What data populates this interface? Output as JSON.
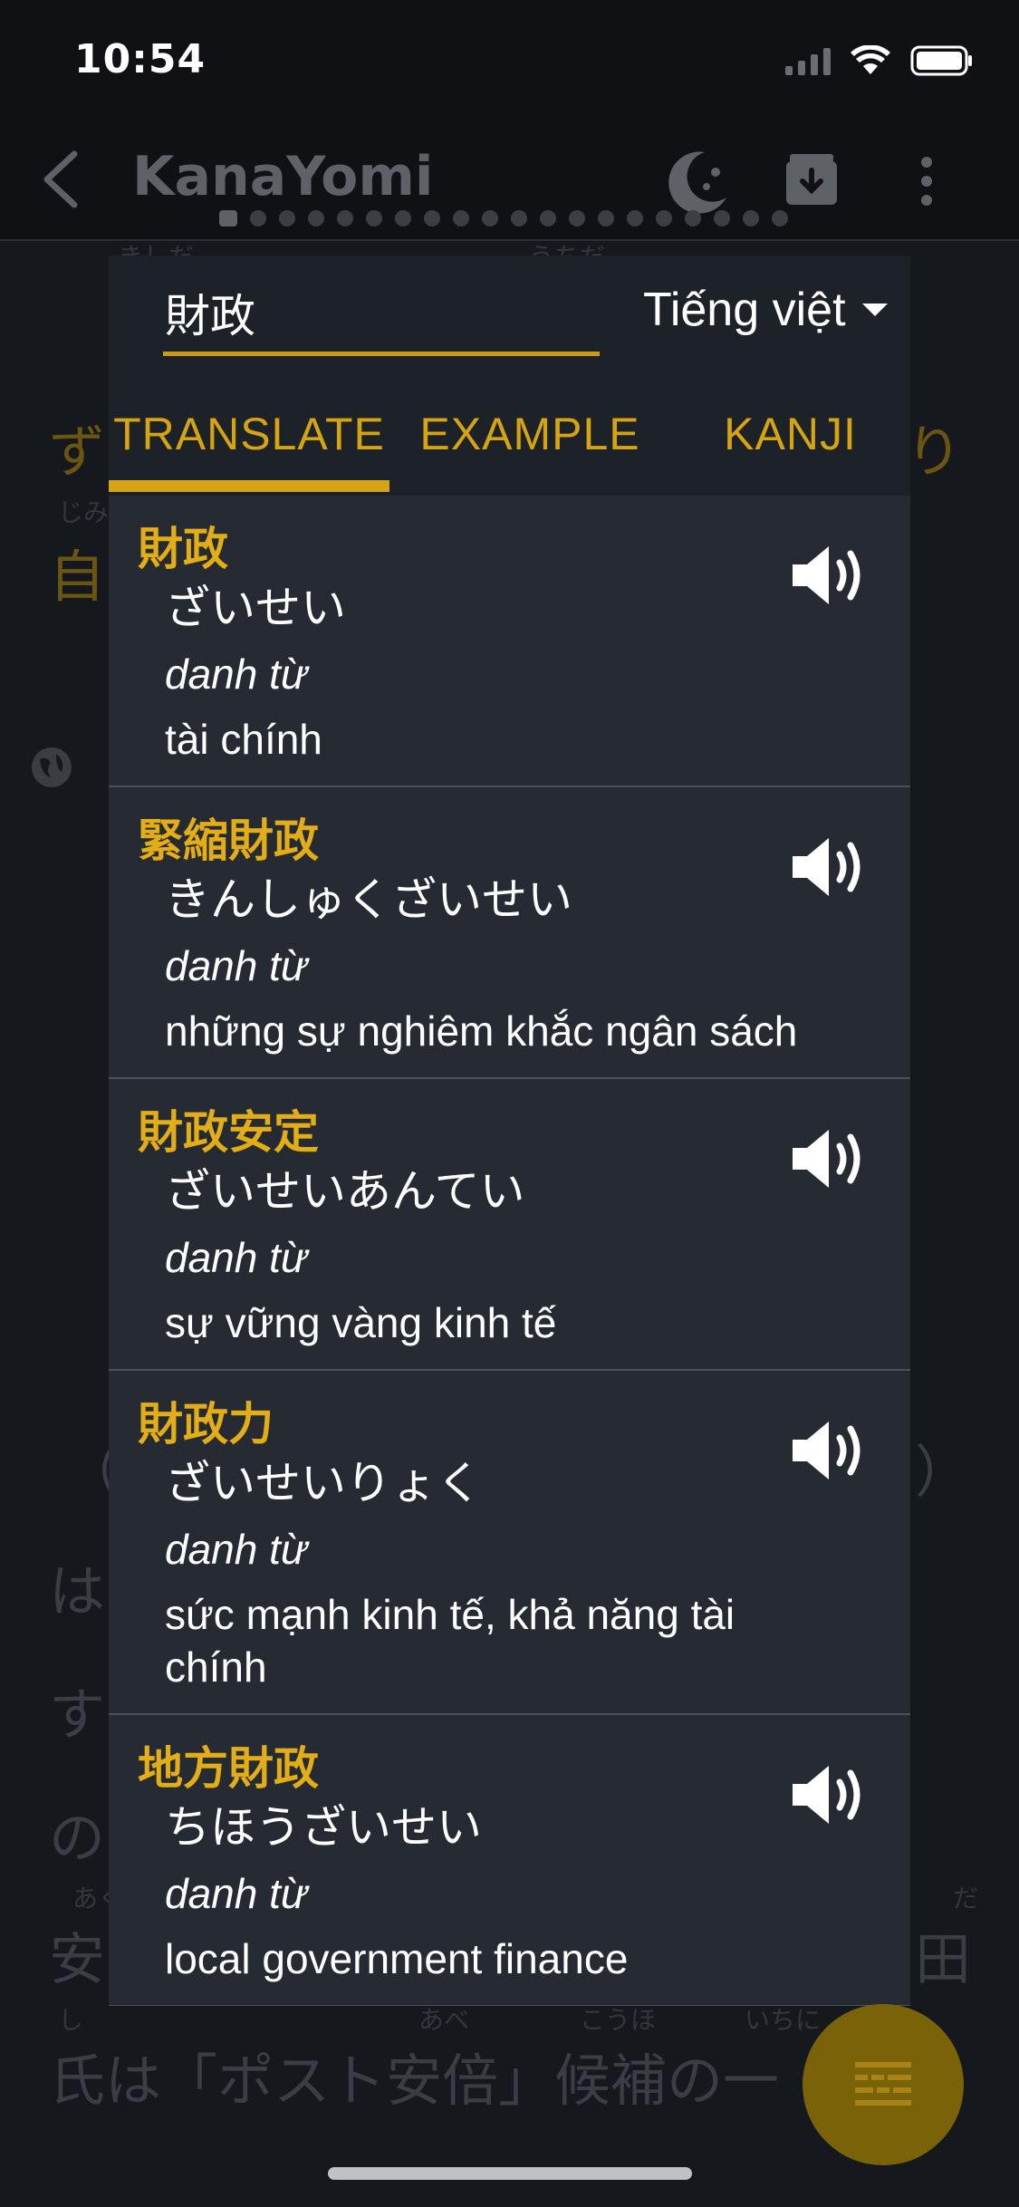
{
  "status_bar": {
    "time": "10:54"
  },
  "app_bar": {
    "title": "KanaYomi"
  },
  "background": {
    "line1": "「",
    "line2": "ず",
    "line3": "自",
    "line4": "（",
    "line5": "（",
    "line6": "は",
    "line7": "す",
    "line8": "の",
    "line9a": "安",
    "line9b": "田",
    "line10": "氏は「ポスト安倍」候補の一",
    "line2_right": "り",
    "line5_right": "）",
    "furi1": "きしだ",
    "furi2": "うちだ",
    "furi3": "じみ",
    "furi4": "あく",
    "furi5": "だ",
    "furi6": "し",
    "furi7": "あべ",
    "furi8": "こうほ",
    "furi9": "いちに"
  },
  "dictionary": {
    "search_value": "財政",
    "language": "Tiếng việt",
    "tabs": [
      "TRANSLATE",
      "EXAMPLE",
      "KANJI"
    ],
    "entries": [
      {
        "word": "財政",
        "reading": "ざいせい",
        "pos": "danh từ",
        "meaning": "tài chính"
      },
      {
        "word": "緊縮財政",
        "reading": "きんしゅくざいせい",
        "pos": "danh từ",
        "meaning": "những sự nghiêm khắc ngân sách"
      },
      {
        "word": "財政安定",
        "reading": "ざいせいあんてい",
        "pos": "danh từ",
        "meaning": "sự vững vàng kinh tế"
      },
      {
        "word": "財政力",
        "reading": "ざいせいりょく",
        "pos": "danh từ",
        "meaning": "sức mạnh kinh tế, khả năng tài chính"
      },
      {
        "word": "地方財政",
        "reading": "ちほうざいせい",
        "pos": "danh từ",
        "meaning": "local government finance"
      }
    ]
  },
  "colors": {
    "accent": "#d4a414",
    "modal": "#252a33",
    "modal_header": "#1d2128"
  }
}
